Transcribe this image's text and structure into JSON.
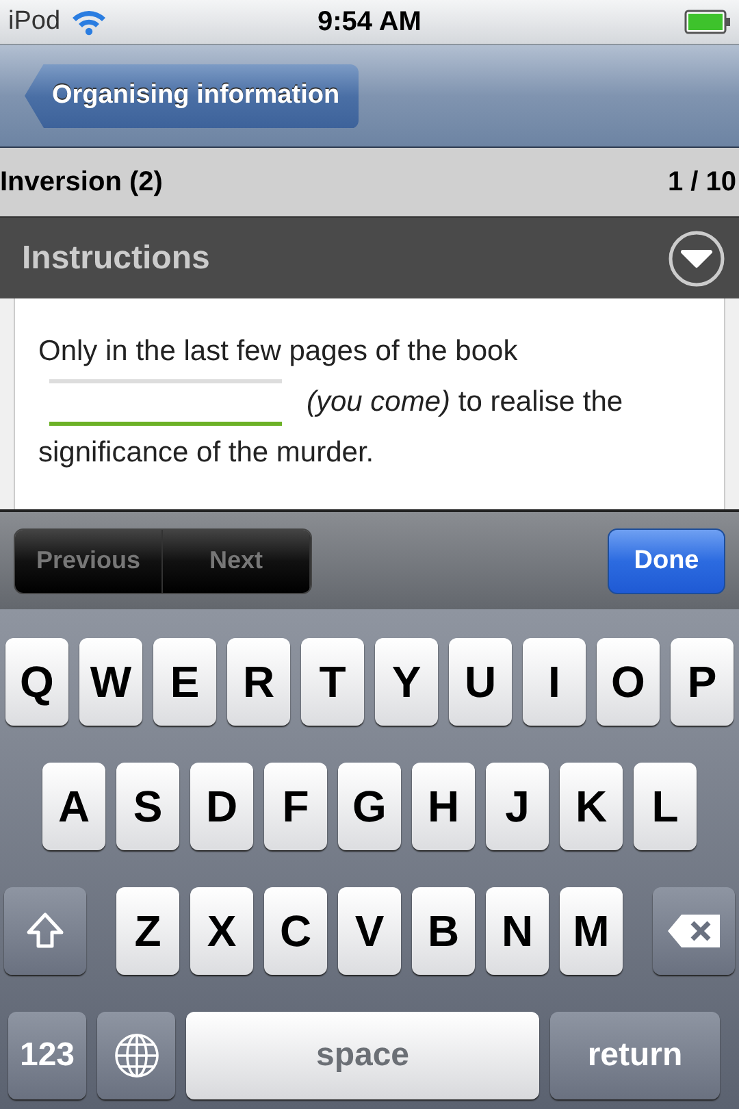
{
  "status_bar": {
    "device": "iPod",
    "time": "9:54 AM"
  },
  "nav_bar": {
    "back_button": "Organising information"
  },
  "exercise": {
    "title": "Inversion (2)",
    "progress": "1 / 10"
  },
  "instructions": {
    "title": "Instructions",
    "expanded": false
  },
  "question": {
    "before": "Only in the last few pages of the book",
    "answer": {
      "focused": true
    },
    "after_lines": [
      "*(you come)* to realise the",
      "significance of the murder."
    ]
  },
  "accessory_bar": {
    "buttons": [
      {
        "label": "Previous",
        "disabled": true
      },
      {
        "label": "Next",
        "disabled": true
      }
    ],
    "done": "Done"
  },
  "keyboard": {
    "rows": [
      [
        "Q",
        "W",
        "E",
        "R",
        "T",
        "Y",
        "U",
        "I",
        "O",
        "P"
      ],
      [
        "A",
        "S",
        "D",
        "F",
        "G",
        "H",
        "J",
        "K",
        "L"
      ],
      [
        "Z",
        "X",
        "C",
        "V",
        "B",
        "N",
        "M"
      ]
    ],
    "bottom_row": [
      {
        "kind": "label",
        "label": "123"
      },
      {
        "kind": "globe"
      },
      {
        "kind": "space",
        "label": "space"
      },
      {
        "kind": "label",
        "label": "return"
      }
    ]
  }
}
